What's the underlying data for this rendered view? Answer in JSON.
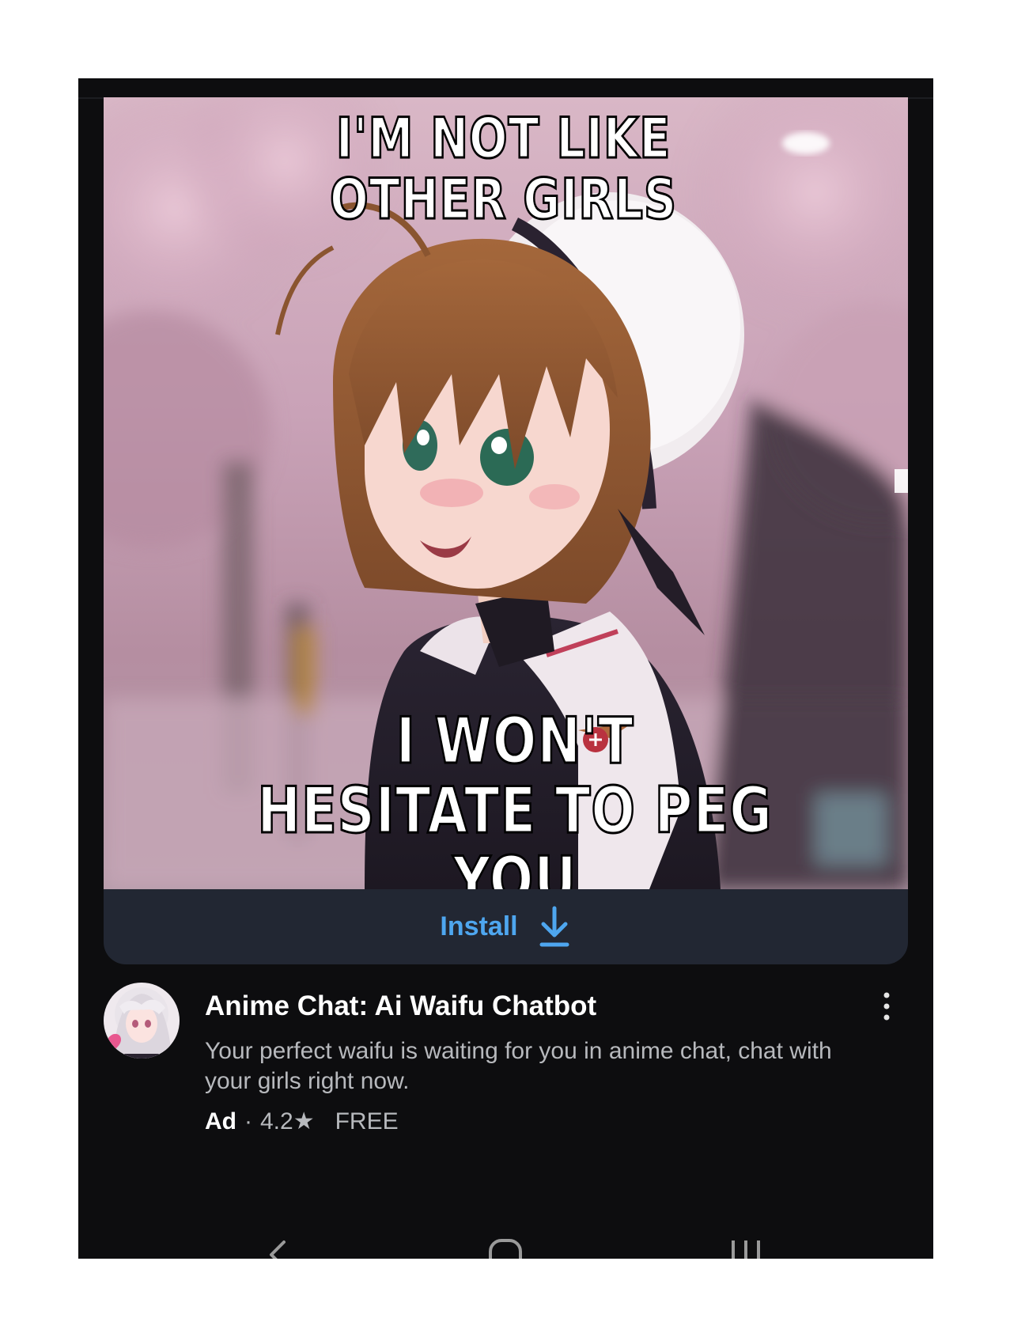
{
  "ad": {
    "image_text_top": "I'M NOT LIKE\nOTHER GIRLS",
    "image_text_bottom": "I WON'T\nHESITATE TO PEG YOU",
    "install_label": "Install",
    "app_title": "Anime Chat: Ai Waifu Chatbot",
    "description": "Your perfect waifu is waiting for you in anime chat, chat with your girls right now.",
    "ad_label": "Ad",
    "separator": "·",
    "rating": "4.2★",
    "price": "FREE"
  },
  "icons": {
    "install": "download-arrow-icon",
    "more": "more-vertical-icon",
    "nav_back": "back-chevron-icon",
    "nav_home": "home-icon",
    "nav_recents": "recents-icon"
  },
  "colors": {
    "screen_bg": "#0d0d0f",
    "install_bar_bg": "#222733",
    "accent": "#4ea6ef",
    "title": "#ffffff",
    "secondary_text": "#b7b9bd"
  }
}
